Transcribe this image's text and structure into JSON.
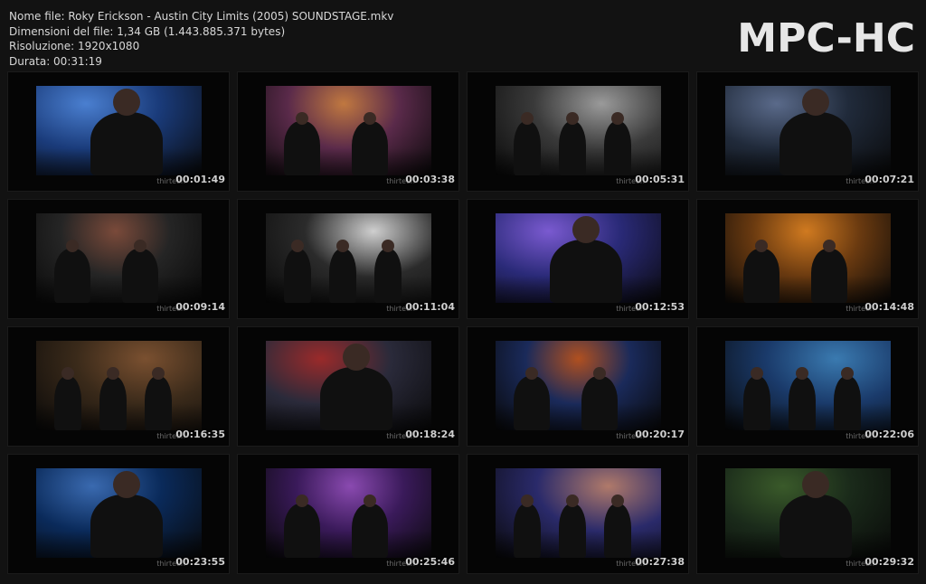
{
  "header": {
    "file_name": "Nome file: Roky Erickson - Austin City Limits (2005) SOUNDSTAGE.mkv",
    "file_size": "Dimensioni del file: 1,34 GB (1.443.885.371 bytes)",
    "resolution": "Risoluzione: 1920x1080",
    "duration": "Durata: 00:31:19"
  },
  "logo": "MPC-HC",
  "watermark": "thirteen",
  "thumbnails": [
    {
      "time": "00:01:49",
      "bg": "#1a3b7a",
      "accent": "#4a7fd0"
    },
    {
      "time": "00:03:38",
      "bg": "#5a2a4a",
      "accent": "#c07840"
    },
    {
      "time": "00:05:31",
      "bg": "#3a3a3a",
      "accent": "#9a9a9a"
    },
    {
      "time": "00:07:21",
      "bg": "#202a3a",
      "accent": "#5a6a8a"
    },
    {
      "time": "00:09:14",
      "bg": "#252525",
      "accent": "#7a4a3a"
    },
    {
      "time": "00:11:04",
      "bg": "#2b2b2b",
      "accent": "#cfcfcf"
    },
    {
      "time": "00:12:53",
      "bg": "#2a2a78",
      "accent": "#7a5ad0"
    },
    {
      "time": "00:14:48",
      "bg": "#6a3a10",
      "accent": "#d07a20"
    },
    {
      "time": "00:16:35",
      "bg": "#3a2a1a",
      "accent": "#7a5030"
    },
    {
      "time": "00:18:24",
      "bg": "#2a2a3a",
      "accent": "#9a2a2a"
    },
    {
      "time": "00:20:17",
      "bg": "#1a2a5a",
      "accent": "#b05020"
    },
    {
      "time": "00:22:06",
      "bg": "#1a3a6a",
      "accent": "#3a7ab0"
    },
    {
      "time": "00:23:55",
      "bg": "#0a2a5a",
      "accent": "#3a6ab0"
    },
    {
      "time": "00:25:46",
      "bg": "#3a1a5a",
      "accent": "#8a4ab0"
    },
    {
      "time": "00:27:38",
      "bg": "#2a2a6a",
      "accent": "#b07a6a"
    },
    {
      "time": "00:29:32",
      "bg": "#1a2a1a",
      "accent": "#3a5a2a"
    }
  ]
}
